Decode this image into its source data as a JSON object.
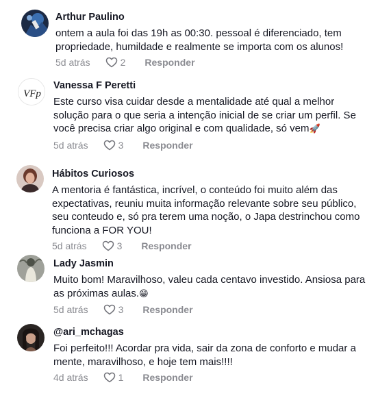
{
  "reply_label": "Responder",
  "comments": [
    {
      "username": "Arthur Paulino",
      "text": "ontem a aula foi das 19h as 00:30. pessoal é diferenciado, tem propriedade, humildade e realmente se importa com os alunos!",
      "time": "5d atrás",
      "likes": "2",
      "emoji": ""
    },
    {
      "username": "Vanessa F Peretti",
      "text": "Este curso visa cuidar desde a mentalidade até qual a melhor solução para o que seria a intenção inicial de se criar um perfil. Se você precisa criar algo original e com qualidade, só vem",
      "time": "5d atrás",
      "likes": "3",
      "emoji": "🚀",
      "avatar_text": "VFp"
    },
    {
      "username": "Hábitos Curiosos",
      "text": "A mentoria é fantástica, incrível, o conteúdo foi muito além das expectativas, reuniu muita informação relevante sobre seu público, seu conteudo e, só pra terem uma noção, o Japa destrinchou como funciona a FOR YOU!",
      "time": "5d atrás",
      "likes": "3",
      "emoji": ""
    },
    {
      "username": "Lady Jasmin",
      "text": "Muito bom! Maravilhoso, valeu cada centavo investido. Ansiosa para as próximas aulas.",
      "time": "5d atrás",
      "likes": "3",
      "emoji": "😁"
    },
    {
      "username": "@ari_mchagas",
      "text": "Foi perfeito!!! Acordar pra vida, sair da zona de conforto e mudar a mente, maravilhoso, e hoje tem mais!!!!",
      "time": "4d atrás",
      "likes": "1",
      "emoji": ""
    }
  ]
}
